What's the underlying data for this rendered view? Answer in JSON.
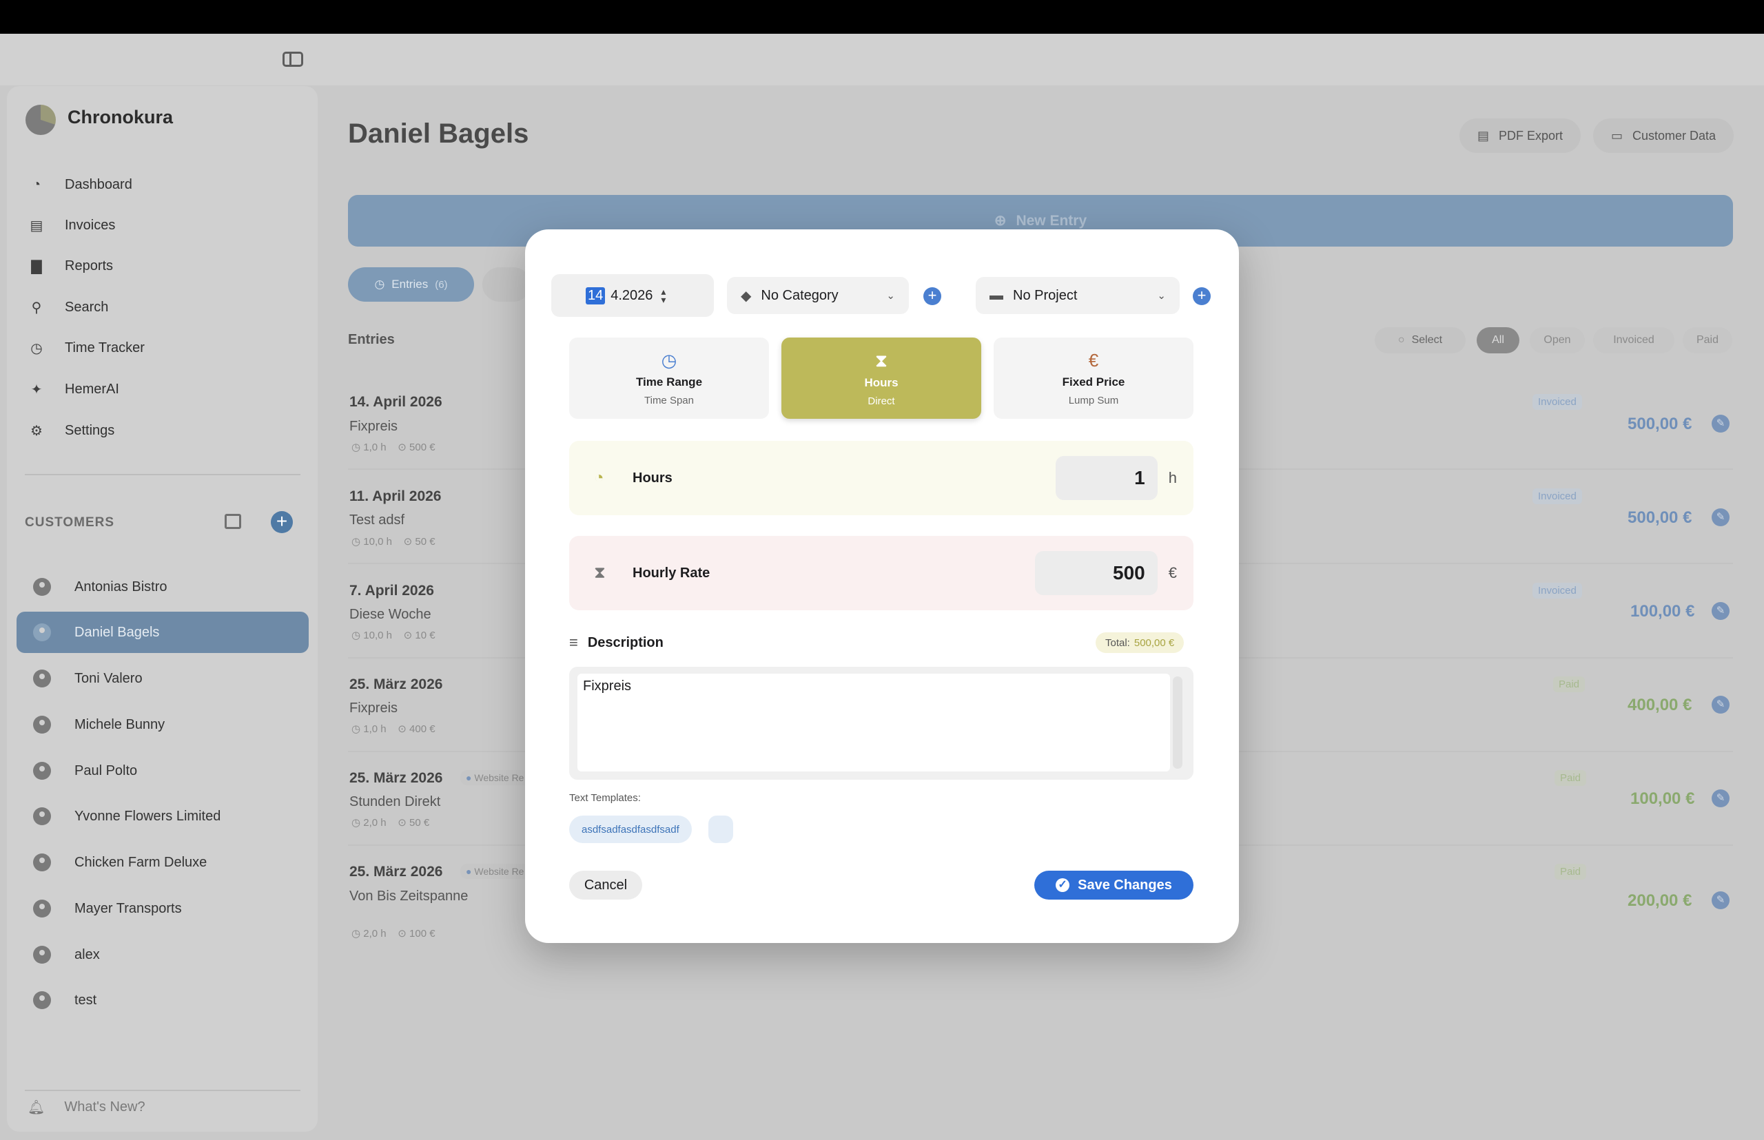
{
  "app": {
    "name": "Chronokura"
  },
  "sidebar": {
    "nav": [
      {
        "label": "Dashboard",
        "icon": "dashboard-icon"
      },
      {
        "label": "Invoices",
        "icon": "document-icon"
      },
      {
        "label": "Reports",
        "icon": "chart-icon"
      },
      {
        "label": "Search",
        "icon": "search-icon"
      },
      {
        "label": "Time Tracker",
        "icon": "clock-icon"
      },
      {
        "label": "HemerAI",
        "icon": "sparkle-icon"
      },
      {
        "label": "Settings",
        "icon": "gear-icon"
      }
    ],
    "customers_header": "CUSTOMERS",
    "customers": [
      "Antonias Bistro",
      "Daniel Bagels",
      "Toni Valero",
      "Michele Bunny",
      "Paul Polto",
      "Yvonne Flowers Limited",
      "Chicken Farm Deluxe",
      "Mayer Transports",
      "alex",
      "test"
    ],
    "active_customer": "Daniel Bagels",
    "whats_new": "What's New?"
  },
  "main": {
    "title": "Daniel Bagels",
    "pdf_export": "PDF Export",
    "customer_data": "Customer Data",
    "new_entry": "New Entry",
    "tab_entries": "Entries",
    "tab_entries_count": "(6)",
    "entries_label": "Entries",
    "filters": {
      "select": "Select",
      "all": "All",
      "open": "Open",
      "invoiced": "Invoiced",
      "paid": "Paid"
    },
    "rows": [
      {
        "date": "14. April 2026",
        "desc": "Fixpreis",
        "hours": "1,0 h",
        "rate": "500 €",
        "tag": "",
        "status": "Invoiced",
        "amount": "500,00 €"
      },
      {
        "date": "11. April 2026",
        "desc": "Test adsf",
        "hours": "10,0 h",
        "rate": "50 €",
        "tag": "",
        "status": "Invoiced",
        "amount": "500,00 €"
      },
      {
        "date": "7. April 2026",
        "desc": "Diese Woche",
        "hours": "10,0 h",
        "rate": "10 €",
        "tag": "",
        "status": "Invoiced",
        "amount": "100,00 €"
      },
      {
        "date": "25. März 2026",
        "desc": "Fixpreis",
        "hours": "1,0 h",
        "rate": "400 €",
        "tag": "",
        "status": "Paid",
        "amount": "400,00 €"
      },
      {
        "date": "25. März 2026",
        "desc": "Stunden Direkt",
        "hours": "2,0 h",
        "rate": "50 €",
        "tag": "Website Re",
        "status": "Paid",
        "amount": "100,00 €"
      },
      {
        "date": "25. März 2026",
        "desc": "Von Bis Zeitspanne",
        "hours": "2,0 h",
        "rate": "100 €",
        "tag": "Website Re",
        "status": "Paid",
        "amount": "200,00 €"
      }
    ]
  },
  "modal": {
    "date_day": "14",
    "date_rest": "4.2026",
    "category": "No Category",
    "project": "No Project",
    "types": [
      {
        "title": "Time Range",
        "sub": "Time Span",
        "icon": "clock-check-icon"
      },
      {
        "title": "Hours",
        "sub": "Direct",
        "icon": "hourglass-icon"
      },
      {
        "title": "Fixed Price",
        "sub": "Lump Sum",
        "icon": "euro-icon"
      }
    ],
    "hours_label": "Hours",
    "hours_value": "1",
    "hours_unit": "h",
    "rate_label": "Hourly Rate",
    "rate_value": "500",
    "rate_unit": "€",
    "description_label": "Description",
    "total_label": "Total:",
    "total_value": "500,00 €",
    "description_text": "Fixpreis",
    "templates_label": "Text Templates:",
    "template_chip": "asdfsadfasdfasdfsadf",
    "cancel": "Cancel",
    "save": "Save Changes"
  }
}
